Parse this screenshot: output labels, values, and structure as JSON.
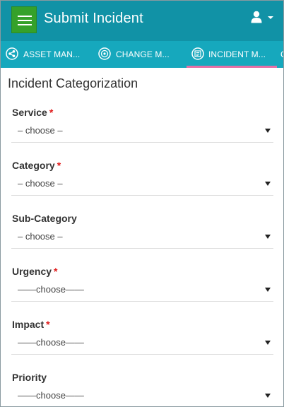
{
  "header": {
    "title": "Submit Incident",
    "menu_icon": "hamburger-icon",
    "user_icon": "user-icon",
    "user_caret_icon": "caret-down-icon",
    "accent_color": "#1192a6",
    "menu_button_color": "#35a12a"
  },
  "tabs": [
    {
      "label": "ASSET MAN...",
      "icon": "asset-management-icon",
      "active": false
    },
    {
      "label": "CHANGE M...",
      "icon": "change-management-icon",
      "active": false
    },
    {
      "label": "INCIDENT M...",
      "icon": "incident-management-icon",
      "active": true
    }
  ],
  "tabbar": {
    "color": "#16a8bd",
    "active_indicator_color": "#e56fa5"
  },
  "form": {
    "section_title": "Incident Categorization",
    "required_marker": "*",
    "fields": [
      {
        "label": "Service",
        "required": true,
        "value": "– choose –"
      },
      {
        "label": "Category",
        "required": true,
        "value": "– choose –"
      },
      {
        "label": "Sub-Category",
        "required": false,
        "value": "– choose –"
      },
      {
        "label": "Urgency",
        "required": true,
        "value": "——choose——"
      },
      {
        "label": "Impact",
        "required": true,
        "value": "——choose——"
      },
      {
        "label": "Priority",
        "required": false,
        "value": "——choose——"
      }
    ]
  }
}
